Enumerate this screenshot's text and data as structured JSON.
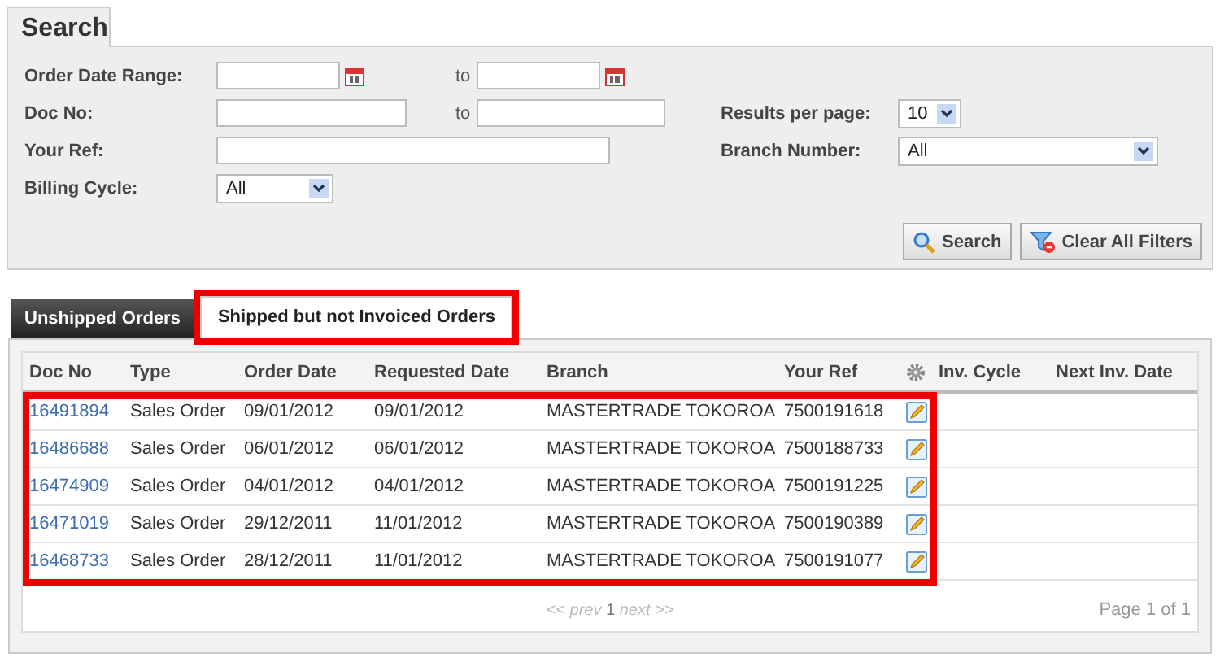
{
  "search": {
    "title": "Search",
    "order_date_range": {
      "label": "Order Date Range:",
      "to": "to"
    },
    "doc_no": {
      "label": "Doc No:",
      "to": "to"
    },
    "your_ref": {
      "label": "Your Ref:"
    },
    "billing_cycle": {
      "label": "Billing Cycle:",
      "value": "All"
    },
    "results_per_page": {
      "label": "Results per page:",
      "value": "10"
    },
    "branch_number": {
      "label": "Branch Number:",
      "value": "All"
    },
    "buttons": [
      {
        "kind": "search",
        "label": "Search"
      },
      {
        "kind": "clear",
        "label": "Clear All Filters"
      }
    ]
  },
  "tabs": [
    {
      "label": "Unshipped Orders",
      "selected": false,
      "highlighted": false
    },
    {
      "label": "Shipped but not Invoiced Orders",
      "selected": true,
      "highlighted": true
    }
  ],
  "table": {
    "columns": [
      "Doc No",
      "Type",
      "Order Date",
      "Requested Date",
      "Branch",
      "Your Ref",
      "Inv. Cycle",
      "Next Inv. Date"
    ],
    "rows_highlighted": true,
    "rows": [
      {
        "doc_no": "16491894",
        "type": "Sales Order",
        "order_date": "09/01/2012",
        "requested_date": "09/01/2012",
        "branch": "MASTERTRADE TOKOROA",
        "your_ref": "7500191618"
      },
      {
        "doc_no": "16486688",
        "type": "Sales Order",
        "order_date": "06/01/2012",
        "requested_date": "06/01/2012",
        "branch": "MASTERTRADE TOKOROA",
        "your_ref": "7500188733"
      },
      {
        "doc_no": "16474909",
        "type": "Sales Order",
        "order_date": "04/01/2012",
        "requested_date": "04/01/2012",
        "branch": "MASTERTRADE TOKOROA",
        "your_ref": "7500191225"
      },
      {
        "doc_no": "16471019",
        "type": "Sales Order",
        "order_date": "29/12/2011",
        "requested_date": "11/01/2012",
        "branch": "MASTERTRADE TOKOROA",
        "your_ref": "7500190389"
      },
      {
        "doc_no": "16468733",
        "type": "Sales Order",
        "order_date": "28/12/2011",
        "requested_date": "11/01/2012",
        "branch": "MASTERTRADE TOKOROA",
        "your_ref": "7500191077"
      }
    ]
  },
  "pager": {
    "prev": "<< prev",
    "page": "1",
    "next": "next >>",
    "summary": "Page 1 of 1"
  }
}
